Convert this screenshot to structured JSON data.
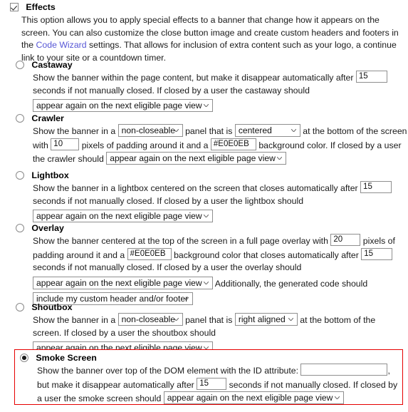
{
  "section": {
    "checkbox_label": "Effects",
    "checkbox_checked": true,
    "description_part1": "This option allows you to apply special effects to a banner that change how it appears on the screen. You can also customize the close button image and create custom headers and footers in the ",
    "description_link": "Code Wizard",
    "description_part2": " settings. That allows for inclusion of extra content such as your logo, a continue link to your site or a countdown timer."
  },
  "options": {
    "castaway": {
      "title": "Castaway",
      "selected": false,
      "text1": "Show the banner within the page content, but make it disappear automatically after",
      "seconds_value": "15",
      "text2": "seconds if not manually closed. If closed by a user the castaway should",
      "close_action": "appear again on the next eligible page view"
    },
    "crawler": {
      "title": "Crawler",
      "selected": false,
      "text1": "Show the banner in a",
      "closeable": "non-closeable",
      "text2": "panel that is",
      "alignment": "centered",
      "text3": "at the bottom of the screen with",
      "padding_value": "10",
      "text4": "pixels of padding around it and a",
      "bg_color": "#E0E0EB",
      "text5": "background color. If closed by a user the crawler should",
      "close_action": "appear again on the next eligible page view"
    },
    "lightbox": {
      "title": "Lightbox",
      "selected": false,
      "text1": "Show the banner in a lightbox centered on the screen that closes automatically after",
      "seconds_value": "15",
      "text2": "seconds if not manually closed. If closed by a user the lightbox should",
      "close_action": "appear again on the next eligible page view"
    },
    "overlay": {
      "title": "Overlay",
      "selected": false,
      "text1": "Show the banner centered at the top of the screen in a full page overlay with",
      "padding_value": "20",
      "text2": "pixels of padding around it and a",
      "bg_color": "#E0E0EB",
      "text3": "background color that closes automatically after",
      "seconds_value": "15",
      "text4": "seconds if not manually closed. If closed by a user the overlay should",
      "close_action": "appear again on the next eligible page view",
      "text5": "Additionally, the generated code should",
      "code_option": "include my custom header and/or footer"
    },
    "shoutbox": {
      "title": "Shoutbox",
      "selected": false,
      "text1": "Show the banner in a",
      "closeable": "non-closeable",
      "text2": "panel that is",
      "alignment": "right aligned",
      "text3": "at the bottom of the screen. If closed by a user the shoutbox should",
      "close_action": "appear again on the next eligible page view"
    },
    "smokescreen": {
      "title": "Smoke Screen",
      "selected": true,
      "text1": "Show the banner over top of the DOM element with the ID attribute:",
      "dom_id_value": "",
      "text2": ", but make it disappear automatically after",
      "seconds_value": "15",
      "text3": "seconds if not manually closed. If closed by a user the smoke screen should",
      "close_action": "appear again on the next eligible page view"
    }
  },
  "colors": {
    "link": "#5757d6",
    "highlight_border": "#e60000",
    "text": "#1a1a1a"
  }
}
